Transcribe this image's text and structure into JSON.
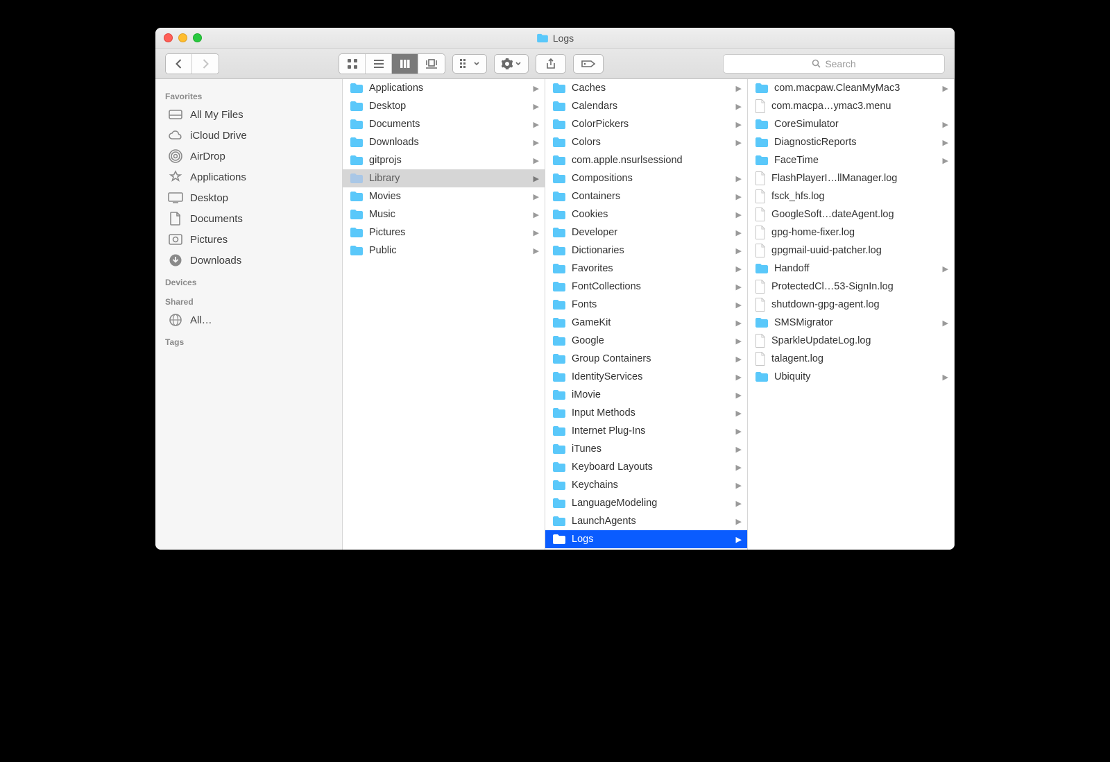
{
  "window": {
    "title": "Logs"
  },
  "colors": {
    "folder": "#5ac8fa",
    "folder_dim": "#a9c7e6",
    "accent": "#0a5cff"
  },
  "search": {
    "placeholder": "Search"
  },
  "sidebar": {
    "sections": [
      {
        "header": "Favorites",
        "items": [
          {
            "icon": "all-my-files",
            "label": "All My Files"
          },
          {
            "icon": "icloud",
            "label": "iCloud Drive"
          },
          {
            "icon": "airdrop",
            "label": "AirDrop"
          },
          {
            "icon": "apps",
            "label": "Applications"
          },
          {
            "icon": "desktop",
            "label": "Desktop"
          },
          {
            "icon": "documents",
            "label": "Documents"
          },
          {
            "icon": "pictures",
            "label": "Pictures"
          },
          {
            "icon": "downloads",
            "label": "Downloads"
          }
        ]
      },
      {
        "header": "Devices",
        "items": []
      },
      {
        "header": "Shared",
        "items": [
          {
            "icon": "network",
            "label": "All…"
          }
        ]
      },
      {
        "header": "Tags",
        "items": []
      }
    ]
  },
  "columns": [
    {
      "items": [
        {
          "type": "folder",
          "label": "Applications",
          "hasChildren": true
        },
        {
          "type": "folder",
          "label": "Desktop",
          "hasChildren": true
        },
        {
          "type": "folder",
          "label": "Documents",
          "hasChildren": true
        },
        {
          "type": "folder",
          "label": "Downloads",
          "hasChildren": true
        },
        {
          "type": "folder",
          "label": "gitprojs",
          "hasChildren": true
        },
        {
          "type": "folder",
          "label": "Library",
          "hasChildren": true,
          "selected": "inactive"
        },
        {
          "type": "folder",
          "label": "Movies",
          "hasChildren": true
        },
        {
          "type": "folder",
          "label": "Music",
          "hasChildren": true
        },
        {
          "type": "folder",
          "label": "Pictures",
          "hasChildren": true
        },
        {
          "type": "folder",
          "label": "Public",
          "hasChildren": true
        }
      ]
    },
    {
      "items": [
        {
          "type": "folder",
          "label": "Caches",
          "hasChildren": true
        },
        {
          "type": "folder",
          "label": "Calendars",
          "hasChildren": true
        },
        {
          "type": "folder",
          "label": "ColorPickers",
          "hasChildren": true
        },
        {
          "type": "folder",
          "label": "Colors",
          "hasChildren": true
        },
        {
          "type": "folder",
          "label": "com.apple.nsurlsessiond",
          "hasChildren": false
        },
        {
          "type": "folder",
          "label": "Compositions",
          "hasChildren": true
        },
        {
          "type": "folder",
          "label": "Containers",
          "hasChildren": true
        },
        {
          "type": "folder",
          "label": "Cookies",
          "hasChildren": true
        },
        {
          "type": "folder",
          "label": "Developer",
          "hasChildren": true
        },
        {
          "type": "folder",
          "label": "Dictionaries",
          "hasChildren": true
        },
        {
          "type": "folder",
          "label": "Favorites",
          "hasChildren": true
        },
        {
          "type": "folder",
          "label": "FontCollections",
          "hasChildren": true
        },
        {
          "type": "folder",
          "label": "Fonts",
          "hasChildren": true
        },
        {
          "type": "folder",
          "label": "GameKit",
          "hasChildren": true
        },
        {
          "type": "folder",
          "label": "Google",
          "hasChildren": true
        },
        {
          "type": "folder",
          "label": "Group Containers",
          "hasChildren": true
        },
        {
          "type": "folder",
          "label": "IdentityServices",
          "hasChildren": true
        },
        {
          "type": "folder",
          "label": "iMovie",
          "hasChildren": true
        },
        {
          "type": "folder",
          "label": "Input Methods",
          "hasChildren": true
        },
        {
          "type": "folder",
          "label": "Internet Plug-Ins",
          "hasChildren": true
        },
        {
          "type": "folder",
          "label": "iTunes",
          "hasChildren": true
        },
        {
          "type": "folder",
          "label": "Keyboard Layouts",
          "hasChildren": true
        },
        {
          "type": "folder",
          "label": "Keychains",
          "hasChildren": true
        },
        {
          "type": "folder",
          "label": "LanguageModeling",
          "hasChildren": true
        },
        {
          "type": "folder",
          "label": "LaunchAgents",
          "hasChildren": true
        },
        {
          "type": "folder",
          "label": "Logs",
          "hasChildren": true,
          "selected": "active"
        }
      ]
    },
    {
      "items": [
        {
          "type": "folder",
          "label": "com.macpaw.CleanMyMac3",
          "hasChildren": true
        },
        {
          "type": "file",
          "label": "com.macpa…ymac3.menu"
        },
        {
          "type": "folder",
          "label": "CoreSimulator",
          "hasChildren": true
        },
        {
          "type": "folder",
          "label": "DiagnosticReports",
          "hasChildren": true
        },
        {
          "type": "folder",
          "label": "FaceTime",
          "hasChildren": true
        },
        {
          "type": "file",
          "label": "FlashPlayerI…llManager.log"
        },
        {
          "type": "file",
          "label": "fsck_hfs.log"
        },
        {
          "type": "file",
          "label": "GoogleSoft…dateAgent.log"
        },
        {
          "type": "file",
          "label": "gpg-home-fixer.log"
        },
        {
          "type": "file",
          "label": "gpgmail-uuid-patcher.log"
        },
        {
          "type": "folder",
          "label": "Handoff",
          "hasChildren": true
        },
        {
          "type": "file",
          "label": "ProtectedCl…53-SignIn.log"
        },
        {
          "type": "file",
          "label": "shutdown-gpg-agent.log"
        },
        {
          "type": "folder",
          "label": "SMSMigrator",
          "hasChildren": true
        },
        {
          "type": "file",
          "label": "SparkleUpdateLog.log"
        },
        {
          "type": "file",
          "label": "talagent.log"
        },
        {
          "type": "folder",
          "label": "Ubiquity",
          "hasChildren": true
        }
      ]
    }
  ]
}
